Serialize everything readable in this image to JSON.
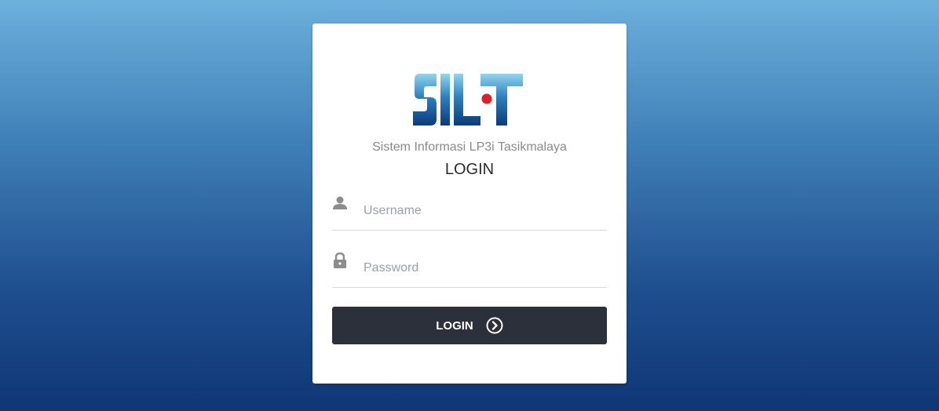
{
  "logo": {
    "text": "SILT",
    "colors": {
      "primary": "#0b3b7a",
      "light": "#7fd0ea",
      "dot": "#e11d2a"
    }
  },
  "subtitle": "Sistem Informasi LP3i Tasikmalaya",
  "title": "LOGIN",
  "username": {
    "placeholder": "Username",
    "value": "",
    "icon": "user-icon"
  },
  "password": {
    "placeholder": "Password",
    "value": "",
    "icon": "lock-icon"
  },
  "login_button": {
    "label": "LOGIN",
    "icon": "chevron-right-circle-icon"
  },
  "colors": {
    "button_bg": "#2c303b",
    "card_bg": "#ffffff",
    "bg_top": "#6cb0dc",
    "bg_bottom": "#0f3676"
  }
}
